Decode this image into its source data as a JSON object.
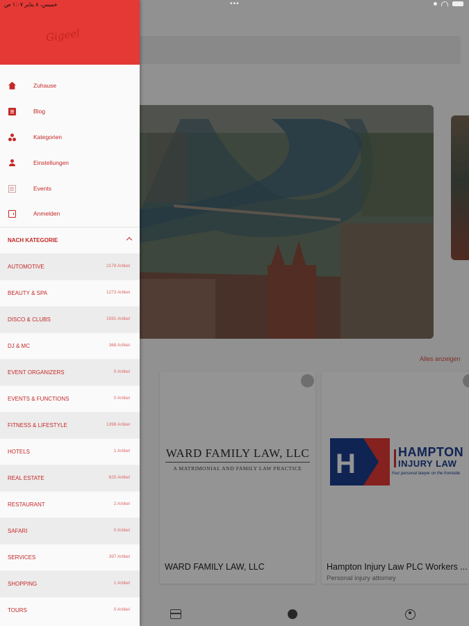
{
  "status_bar": {
    "left_text": "خميس، ٨ يناير ١:٠٧ ص",
    "dots": "•••"
  },
  "drawer": {
    "brand_signature": "Gigeel",
    "menu": [
      {
        "label": "Zuhause",
        "icon": "home-icon"
      },
      {
        "label": "Blog",
        "icon": "blog-icon"
      },
      {
        "label": "Kategorien",
        "icon": "categories-icon"
      },
      {
        "label": "Einstellungen",
        "icon": "user-icon"
      },
      {
        "label": "Events",
        "icon": "events-icon"
      },
      {
        "label": "Anmelden",
        "icon": "login-icon"
      }
    ],
    "section_title": "NACH KATEGORIE",
    "categories": [
      {
        "name": "AUTOMOTIVE",
        "count": "2178 Artikel"
      },
      {
        "name": "BEAUTY & SPA",
        "count": "1273 Artikel"
      },
      {
        "name": "DISCO & CLUBS",
        "count": "1591 Artikel"
      },
      {
        "name": "DJ & MC",
        "count": "368 Artikel"
      },
      {
        "name": "EVENT ORGANIZERS",
        "count": "0 Artikel"
      },
      {
        "name": "EVENTS & FUNCTIONS",
        "count": "0 Artikel"
      },
      {
        "name": "FITNESS & LIFESTYLE",
        "count": "1398 Artikel"
      },
      {
        "name": "HOTELS",
        "count": "1 Artikel"
      },
      {
        "name": "REAL ESTATE",
        "count": "625 Artikel"
      },
      {
        "name": "RESTAURANT",
        "count": "2 Artikel"
      },
      {
        "name": "SAFARI",
        "count": "0 Artikel"
      },
      {
        "name": "SERVICES",
        "count": "397 Artikel"
      },
      {
        "name": "SHOPPING",
        "count": "1 Artikel"
      },
      {
        "name": "TOURS",
        "count": "0 Artikel"
      }
    ]
  },
  "main": {
    "see_all": "Alles anzeigen",
    "cards": [
      {
        "title": "WARD FAMILY LAW, LLC",
        "subtitle": "",
        "logo_name": "WARD FAMILY LAW, LLC",
        "logo_tagline": "A MATRIMONIAL AND FAMILY LAW PRACTICE"
      },
      {
        "title": "Hampton Injury Law PLC Workers ...",
        "subtitle": "Personal injury attorney",
        "logo_line1": "HAMPTON",
        "logo_line2": "INJURY LAW",
        "logo_tagline": "Your personal lawyer on the frontside"
      }
    ]
  },
  "colors": {
    "accent": "#e53935",
    "accent_text": "#c62828"
  }
}
